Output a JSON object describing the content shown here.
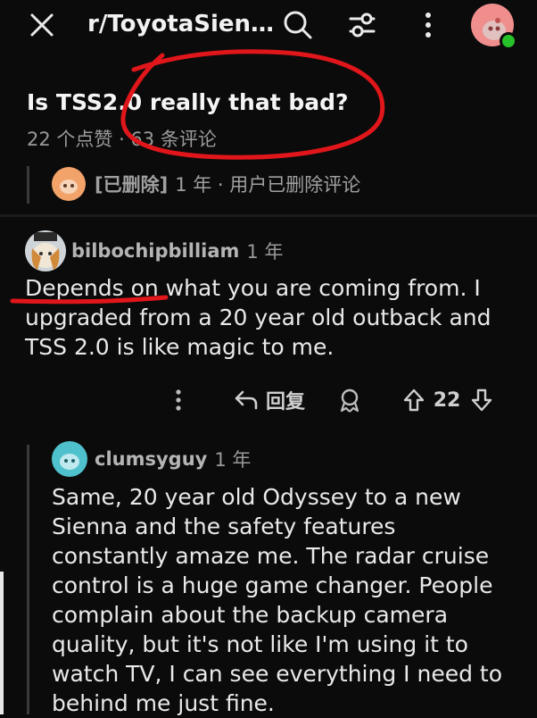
{
  "header": {
    "subreddit": "r/ToyotaSien…",
    "close_icon": "close-icon",
    "search_icon": "search-icon",
    "filter_icon": "filter-icon",
    "more_icon": "more-vertical-icon",
    "avatar_icon": "user-avatar-icon"
  },
  "post": {
    "title": "Is TSS2.0 really that bad?",
    "meta": "22 个点赞 · 63 条评论"
  },
  "deleted_comment": {
    "user": "[已删除]",
    "meta": "1 年 · 用户已删除评论"
  },
  "comment1": {
    "user": "bilbochipbilliam",
    "age": "1 年",
    "body": "Depends on what you are coming from. I upgraded from a 20 year old outback and TSS 2.0 is like magic to me.",
    "actions": {
      "reply_label": "回复",
      "votes": "22"
    }
  },
  "comment2": {
    "user": "clumsyguy",
    "age": "1 年",
    "body": "Same, 20 year old Odyssey to a new Sienna and the safety features constantly amaze me. The radar cruise control is a huge game changer. People complain about the backup camera quality, but it's not like I'm using it to watch TV, I can see everything I need to behind me just fine."
  },
  "colors": {
    "background": "#0b0b0b",
    "annotation": "#e0161b",
    "online": "#27c12a"
  }
}
